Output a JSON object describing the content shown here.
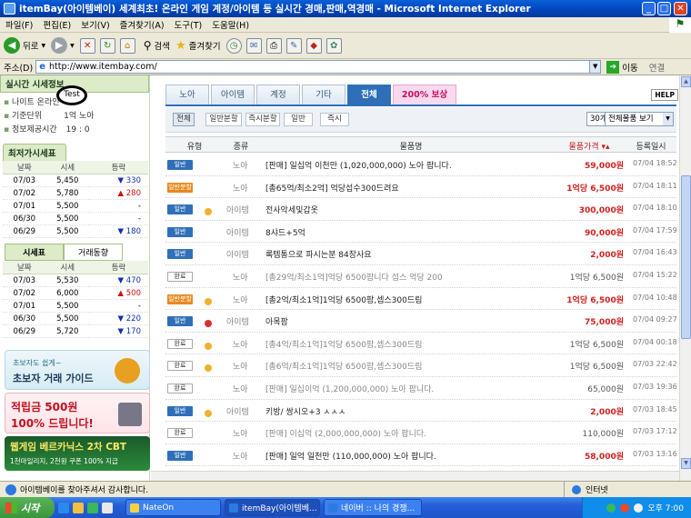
{
  "window": {
    "title": "itemBay(아이템베이) 세계최초! 온라인 게임 계정/아이템 등 실시간 경매,판매,역경매 - Microsoft Internet Explorer"
  },
  "menu": [
    "파일(F)",
    "편집(E)",
    "보기(V)",
    "즐겨찾기(A)",
    "도구(T)",
    "도움말(H)"
  ],
  "toolbar": {
    "back": "뒤로",
    "search": "검색",
    "favorites": "즐겨찾기"
  },
  "address": {
    "label": "주소(D)",
    "url": "http://www.itembay.com/",
    "go": "이동",
    "links": "연결"
  },
  "left": {
    "realtime_title": "실시간 시세정보",
    "realtime_items": [
      "나이트 온라인",
      "기준단위",
      "정보제공시간"
    ],
    "unit_value": "1억 노아",
    "time_value": "19 : 0",
    "overlay_text": "Test",
    "low_title": "최저가시세표",
    "table_headers": [
      "날짜",
      "시세",
      "등락"
    ],
    "low_rows": [
      {
        "date": "07/03",
        "price": "5,450",
        "change": "▼ 330",
        "dir": "dn"
      },
      {
        "date": "07/02",
        "price": "5,780",
        "change": "▲ 280",
        "dir": "up"
      },
      {
        "date": "07/01",
        "price": "5,500",
        "change": "-",
        "dir": ""
      },
      {
        "date": "06/30",
        "price": "5,500",
        "change": "-",
        "dir": ""
      },
      {
        "date": "06/29",
        "price": "5,500",
        "change": "▼ 180",
        "dir": "dn"
      }
    ],
    "tabs": [
      "시세표",
      "거래동향"
    ],
    "market_rows": [
      {
        "date": "07/03",
        "price": "5,530",
        "change": "▼ 470",
        "dir": "dn"
      },
      {
        "date": "07/02",
        "price": "6,000",
        "change": "▲ 500",
        "dir": "up"
      },
      {
        "date": "07/01",
        "price": "5,500",
        "change": "-",
        "dir": ""
      },
      {
        "date": "06/30",
        "price": "5,500",
        "change": "▼ 220",
        "dir": "dn"
      },
      {
        "date": "06/29",
        "price": "5,720",
        "change": "▼ 170",
        "dir": "dn"
      }
    ],
    "banner1": {
      "line1": "초보자도 쉽게~",
      "line2": "초보자 거래 가이드"
    },
    "banner2": {
      "line1": "적립금 500원",
      "line2": "100% 드립니다!"
    },
    "banner3": {
      "line1": "웹게임 베르카닉스 2차 CBT",
      "line2": "1천마일리지, 2천원 쿠폰 100% 지급"
    }
  },
  "main": {
    "tabs": [
      "노아",
      "아이템",
      "계정",
      "기타",
      "전체",
      "200% 보상"
    ],
    "help": "HELP",
    "filters": [
      "전체",
      "일반분할",
      "즉시분할",
      "일반",
      "즉시"
    ],
    "count_select": "30개",
    "view_select": "전체물품 보기",
    "headers": {
      "type": "유형",
      "kind": "종류",
      "name": "물품명",
      "price": "물품가격 ▾▴",
      "date": "등록일시"
    },
    "rows": [
      {
        "badge": "일반",
        "bc": "b-sale",
        "medal": "",
        "kind": "노아",
        "title": "[판매] 일십억 이천만 (1,020,000,000) 노아 팝니다.",
        "tg": false,
        "price": "59,000원",
        "pg": false,
        "date": "07/04 18:52"
      },
      {
        "badge": "일반분할",
        "bc": "b-split",
        "medal": "",
        "kind": "노아",
        "title": "[총65억/최소2억] 억당섭수300드려요",
        "tg": false,
        "price": "1억당 6,500원",
        "pg": false,
        "date": "07/04 18:11"
      },
      {
        "badge": "일반",
        "bc": "b-sale",
        "medal": "gold",
        "kind": "아이템",
        "title": "전사악세및갑옷",
        "tg": false,
        "price": "300,000원",
        "pg": false,
        "date": "07/04 18:10"
      },
      {
        "badge": "일반",
        "bc": "b-sale",
        "medal": "",
        "kind": "아이템",
        "title": "8샤드+5억",
        "tg": false,
        "price": "90,000원",
        "pg": false,
        "date": "07/04 17:59"
      },
      {
        "badge": "일반",
        "bc": "b-sale",
        "medal": "",
        "kind": "아이템",
        "title": "록템통으로 파시는분 84장사요",
        "tg": false,
        "price": "2,000원",
        "pg": false,
        "date": "07/04 16:43"
      },
      {
        "badge": "완료",
        "bc": "b-done",
        "medal": "",
        "kind": "노아",
        "title": "[총29억/최소1억]억당 6500팝니다 섭스 억당 200",
        "tg": true,
        "price": "1억당 6,500원",
        "pg": true,
        "date": "07/04 15:22"
      },
      {
        "badge": "일반분할",
        "bc": "b-split",
        "medal": "gold",
        "kind": "노아",
        "title": "[총2억/최소1억]1억당 6500팜,셉스300드림",
        "tg": false,
        "price": "1억당 6,500원",
        "pg": false,
        "date": "07/04 10:48"
      },
      {
        "badge": "일반",
        "bc": "b-sale",
        "medal": "red",
        "kind": "아이템",
        "title": "아목팜",
        "tg": false,
        "price": "75,000원",
        "pg": false,
        "date": "07/04 09:27"
      },
      {
        "badge": "완료",
        "bc": "b-done",
        "medal": "gold",
        "kind": "노아",
        "title": "[총4억/최소1억]1억당 6500팜,셉스300드림",
        "tg": true,
        "price": "1억당 6,500원",
        "pg": true,
        "date": "07/04 00:18"
      },
      {
        "badge": "완료",
        "bc": "b-done",
        "medal": "gold",
        "kind": "노아",
        "title": "[총6억/최소1억]1억당 6500팜,셉스300드림",
        "tg": true,
        "price": "1억당 6,500원",
        "pg": true,
        "date": "07/03 22:42"
      },
      {
        "badge": "완료",
        "bc": "b-done",
        "medal": "",
        "kind": "노아",
        "title": "[판매] 일십이억 (1,200,000,000) 노아 팝니다.",
        "tg": true,
        "price": "65,000원",
        "pg": true,
        "date": "07/03 19:36"
      },
      {
        "badge": "일반",
        "bc": "b-sale",
        "medal": "gold",
        "kind": "아이템",
        "title": "키방/ 쌍시오+3 ㅅㅅㅅ",
        "tg": false,
        "price": "2,000원",
        "pg": false,
        "date": "07/03 18:45"
      },
      {
        "badge": "완료",
        "bc": "b-done",
        "medal": "",
        "kind": "노아",
        "title": "[판매] 이십억 (2,000,000,000) 노아 팝니다.",
        "tg": true,
        "price": "110,000원",
        "pg": true,
        "date": "07/03 17:12"
      },
      {
        "badge": "일반",
        "bc": "b-sale",
        "medal": "",
        "kind": "노아",
        "title": "[판매] 일억 일천만 (110,000,000) 노아 팝니다.",
        "tg": false,
        "price": "58,000원",
        "pg": false,
        "date": "07/03 13:16"
      }
    ]
  },
  "status": {
    "text": "아이템베이를 찾아주셔서 감사합니다.",
    "zone": "인터넷"
  },
  "taskbar": {
    "start": "시작",
    "tasks": [
      "NateOn",
      "itemBay(아이템베...",
      "네이버 :: 나의 경쟁..."
    ],
    "clock": "오후 7:00"
  }
}
